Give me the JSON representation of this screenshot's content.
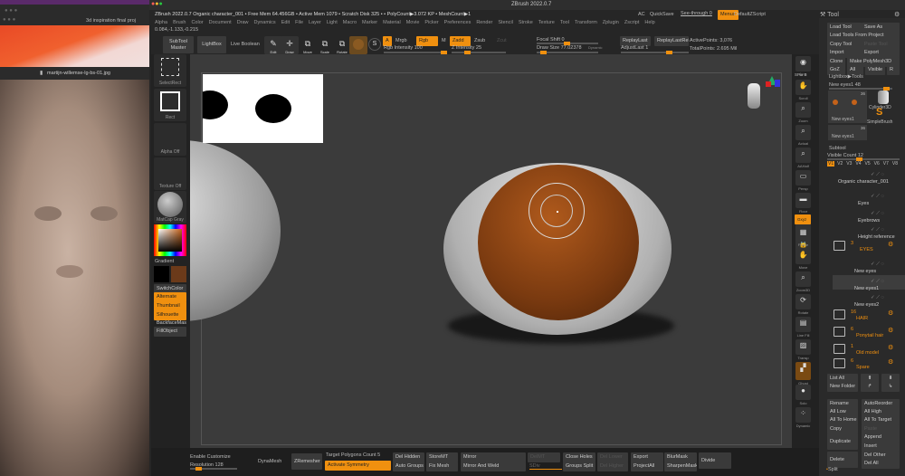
{
  "left_viewer": {
    "window1_title": "3d inspiration final proj",
    "window2_filename": "martijn-willemse-lg-bs-01.jpg"
  },
  "zbrush": {
    "window_title": "ZBrush 2022.0.7",
    "info_line": "ZBrush 2022.0.7 Organic character_001   • Free Mem 64.456GB • Active Mem 1079 • Scratch Disk 325 •  • PolyCount▶3.072 KP  • MeshCount▶1",
    "top_right": {
      "ac": "AC",
      "quicksave": "QuickSave",
      "see_through": "See-through  0",
      "menus": "Menus",
      "default_zscript": "DefaultZScript"
    },
    "menu": [
      "Alpha",
      "Brush",
      "Color",
      "Document",
      "Draw",
      "Dynamics",
      "Edit",
      "File",
      "Layer",
      "Light",
      "Macro",
      "Marker",
      "Material",
      "Movie",
      "Picker",
      "Preferences",
      "Render",
      "Stencil",
      "Stroke",
      "Texture",
      "Tool",
      "Transform",
      "Zplugin",
      "Zscript",
      "Help"
    ],
    "coords": "0.084,-1.133,-0.215",
    "toolbar": {
      "subtool_master": "SubTool Master",
      "lightbox": "LightBox",
      "live_boolean": "Live Boolean",
      "edit": "Edit",
      "draw": "Draw",
      "move": "Move",
      "scale": "Scale",
      "rotate": "Rotate",
      "a": "A",
      "mrgb": "Mrgb",
      "rgb": "Rgb",
      "m": "M",
      "zadd": "Zadd",
      "zsub": "Zsub",
      "zcut": "Zcut",
      "rgb_intensity": "Rgb Intensity 100",
      "z_intensity": "Z Intensity 25",
      "focal_shift": "Focal Shift 0",
      "draw_size": "Draw Size 77.02378",
      "dynamic": "Dynamic",
      "replay_last": "ReplayLast",
      "replay_last_rel": "ReplayLastRel",
      "adjust_last": "AdjustLast 1",
      "active_points": "ActivePoints: 3,076",
      "total_points": "TotalPoints: 2.695 Mil",
      "rgb_intensity_pct": 100,
      "z_intensity_pct": 25
    },
    "left_shelf": {
      "select_rect": "SelectRect",
      "rect": "Rect",
      "alpha_off": "Alpha Off",
      "texture_off": "Texture Off",
      "matcap": "MatCap Gray",
      "gradient": "Gradient",
      "switch_color": "SwitchColor",
      "alternate": "Alternate",
      "thumbnail": "Thumbnail",
      "silhouette": "Silhouette",
      "backface_mask": "BackfaceMask",
      "fill_object": "FillObject",
      "main_color": "#000000",
      "secondary_color": "#6b3a1a"
    },
    "right_shelf": [
      "BPR",
      "SPix 3",
      "Scroll",
      "Zoom",
      "Actual",
      "AAHalf",
      "Persp",
      "Floor",
      "L.Sym",
      "Lock",
      "Gxyz",
      "Frame",
      "Move",
      "Zoom3D",
      "Rotate",
      "Line Fill",
      "Transp",
      "Ghost",
      "Solo",
      "Dynamic"
    ],
    "tool_panel": {
      "title": "Tool",
      "buttons": [
        "Load Tool",
        "Save As",
        "Load Tools From Project",
        "Copy Tool",
        "Paste Tool",
        "Import",
        "Export",
        "Clone",
        "Make PolyMesh3D",
        "GoZ",
        "All",
        "Visible",
        "R"
      ],
      "lightbox_tools": "Lightbox▶Tools",
      "current_tool": "New eyes1  48",
      "thumbs": [
        {
          "label": "New eyes1",
          "count": "36"
        },
        {
          "label": "Cylinder3D"
        },
        {
          "label": "SimpleBrush"
        },
        {
          "label": "New eyes1",
          "count": "36"
        }
      ],
      "subtool_title": "Subtool",
      "visible_count": "Visible Count 12",
      "versions": [
        "V1",
        "V2",
        "V3",
        "V4",
        "V5",
        "V6",
        "V7",
        "V8"
      ],
      "subtools": [
        {
          "name": "Organic character_001"
        },
        {
          "name": "Eyes"
        },
        {
          "name": "Eyebrows"
        },
        {
          "name": "Height reference"
        },
        {
          "name": "EYES",
          "count": "3",
          "folder": true
        },
        {
          "name": "New eyes"
        },
        {
          "name": "New eyes1"
        },
        {
          "name": "New eyes2"
        },
        {
          "name": "HAIR",
          "count": "16",
          "folder": true
        },
        {
          "name": "Ponytail hair",
          "count": "6",
          "folder": true
        },
        {
          "name": "Old model",
          "count": "1",
          "folder": true
        },
        {
          "name": "Spare",
          "count": "6",
          "folder": true
        }
      ],
      "list_all": "List All",
      "new_folder": "New Folder",
      "actions": [
        "Rename",
        "AutoReorder",
        "All Low",
        "All High",
        "All To Home",
        "All To Target",
        "Copy",
        "Paste",
        "Duplicate",
        "Append",
        "Insert",
        "Delete",
        "Del Other",
        "Del All"
      ],
      "split": "Split"
    },
    "bottom": {
      "enable_customize": "Enable Customize",
      "resolution": "Resolution 128",
      "dynamesh": "DynaMesh",
      "zremesher": "ZRemesher",
      "target_poly": "Target Polygons Count 5",
      "activate_symmetry": "Activate Symmetry",
      "del_hidden": "Del Hidden",
      "auto_groups": "Auto Groups",
      "storemt": "StoreMT",
      "fix_mesh": "Fix Mesh",
      "mirror": "Mirror",
      "mirror_weld": "Mirror And Weld",
      "delmt": "DelMT",
      "sdiv": "SDiv",
      "close_holes": "Close Holes",
      "groups_split": "Groups Split",
      "del_lower": "Del Lower",
      "del_higher": "Del Higher",
      "export": "Export",
      "project_all": "ProjectAll",
      "blur_mask": "BlurMask",
      "sharpen_mask": "SharpenMask",
      "divide": "Divide"
    }
  }
}
